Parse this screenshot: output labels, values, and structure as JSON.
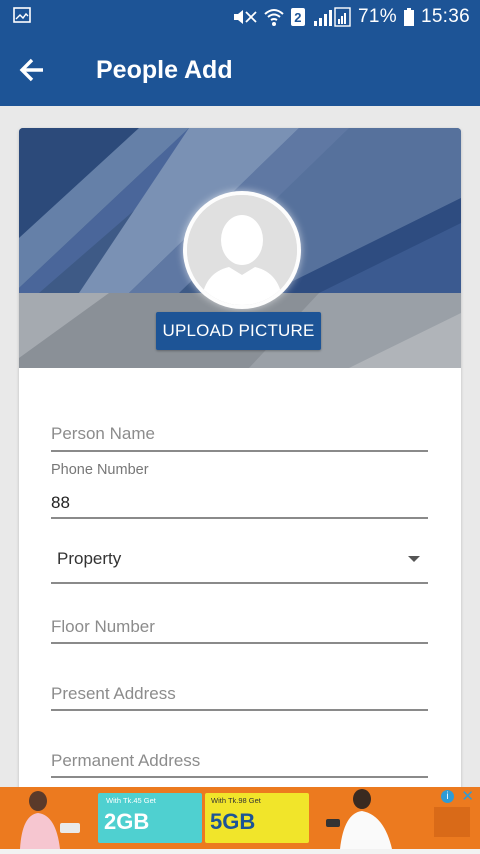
{
  "status_bar": {
    "battery": "71%",
    "time": "15:36",
    "sim_slot": "2",
    "icons": [
      "screenshot-icon",
      "mute-icon",
      "wifi-icon",
      "sim-icon",
      "signal-icon",
      "battery-icon"
    ]
  },
  "app_bar": {
    "title": "People Add",
    "back_icon": "arrow-left-icon"
  },
  "profile": {
    "upload_label": "UPLOAD PICTURE",
    "avatar_icon": "person-placeholder-icon"
  },
  "form": {
    "person_name": {
      "placeholder": "Person Name",
      "value": ""
    },
    "phone_number": {
      "label": "Phone Number",
      "value": "88"
    },
    "property": {
      "selected": "Property",
      "icon": "dropdown-arrow-icon"
    },
    "floor_number": {
      "placeholder": "Floor Number",
      "value": ""
    },
    "present_address": {
      "placeholder": "Present Address",
      "value": ""
    },
    "permanent_address": {
      "placeholder": "Permanent Address",
      "value": ""
    }
  },
  "ad": {
    "offer1_small": "With Tk.45 Get",
    "offer1_big": "2GB",
    "offer2_small": "With Tk.98 Get",
    "offer2_big": "5GB",
    "colors": {
      "background": "#ec7a1f",
      "box1": "#4fd0d0",
      "box2": "#f1e52a"
    }
  },
  "colors": {
    "primary": "#1d5496",
    "background": "#e9e9e9"
  }
}
